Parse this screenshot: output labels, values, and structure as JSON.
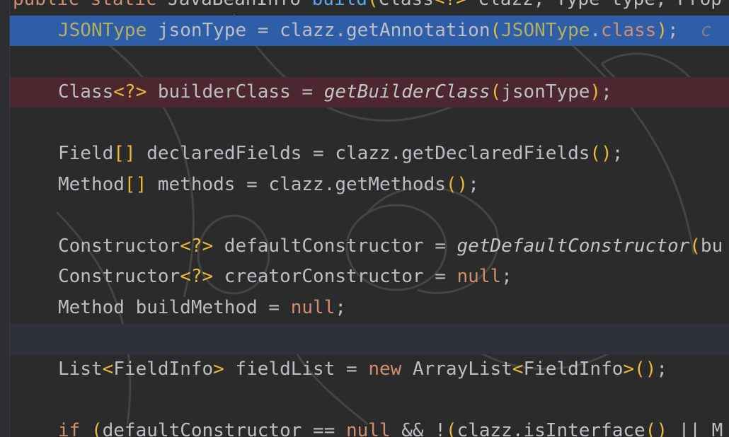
{
  "editor": {
    "lines": [
      {
        "kind": "plain",
        "tokens": [
          {
            "t": "kw",
            "v": "public "
          },
          {
            "t": "kw",
            "v": "static "
          },
          {
            "t": "ty",
            "v": "JavaBeanInfo "
          },
          {
            "t": "fn",
            "v": "build"
          },
          {
            "t": "br",
            "v": "("
          },
          {
            "t": "ty",
            "v": "Class"
          },
          {
            "t": "br",
            "v": "<?>"
          },
          {
            "t": "ty",
            "v": " clazz, Type type, Prop"
          }
        ]
      },
      {
        "kind": "selected",
        "tokens": [
          {
            "t": "an",
            "v": "JSONType"
          },
          {
            "t": "ty",
            "v": " jsonType = clazz.getAnnotation"
          },
          {
            "t": "br",
            "v": "("
          },
          {
            "t": "an",
            "v": "JSONType"
          },
          {
            "t": "ty",
            "v": "."
          },
          {
            "t": "kw",
            "v": "class"
          },
          {
            "t": "br",
            "v": ")"
          },
          {
            "t": "ty",
            "v": ";  "
          },
          {
            "t": "cmt",
            "v": "c"
          }
        ]
      },
      {
        "kind": "plain",
        "tokens": []
      },
      {
        "kind": "breakpoint",
        "tokens": [
          {
            "t": "ty",
            "v": "Class"
          },
          {
            "t": "br",
            "v": "<?>"
          },
          {
            "t": "ty",
            "v": " builderClass = "
          },
          {
            "t": "ital",
            "v": "getBuilderClass"
          },
          {
            "t": "br",
            "v": "("
          },
          {
            "t": "ty",
            "v": "jsonType"
          },
          {
            "t": "br",
            "v": ")"
          },
          {
            "t": "ty",
            "v": ";"
          }
        ]
      },
      {
        "kind": "plain",
        "tokens": []
      },
      {
        "kind": "plain",
        "tokens": [
          {
            "t": "ty",
            "v": "Field"
          },
          {
            "t": "br",
            "v": "[]"
          },
          {
            "t": "ty",
            "v": " declaredFields = clazz.getDeclaredFields"
          },
          {
            "t": "br",
            "v": "()"
          },
          {
            "t": "ty",
            "v": ";"
          }
        ]
      },
      {
        "kind": "plain",
        "tokens": [
          {
            "t": "ty",
            "v": "Method"
          },
          {
            "t": "br",
            "v": "[]"
          },
          {
            "t": "ty",
            "v": " methods = clazz.getMethods"
          },
          {
            "t": "br",
            "v": "()"
          },
          {
            "t": "ty",
            "v": ";"
          }
        ]
      },
      {
        "kind": "plain",
        "tokens": []
      },
      {
        "kind": "plain",
        "tokens": [
          {
            "t": "ty",
            "v": "Constructor"
          },
          {
            "t": "br",
            "v": "<?>"
          },
          {
            "t": "ty",
            "v": " defaultConstructor = "
          },
          {
            "t": "ital",
            "v": "getDefaultConstructor"
          },
          {
            "t": "br",
            "v": "("
          },
          {
            "t": "ty",
            "v": "bu"
          }
        ]
      },
      {
        "kind": "plain",
        "tokens": [
          {
            "t": "ty",
            "v": "Constructor"
          },
          {
            "t": "br",
            "v": "<?>"
          },
          {
            "t": "ty",
            "v": " creatorConstructor = "
          },
          {
            "t": "kw",
            "v": "null"
          },
          {
            "t": "ty",
            "v": ";"
          }
        ]
      },
      {
        "kind": "plain",
        "tokens": [
          {
            "t": "ty",
            "v": "Method buildMethod = "
          },
          {
            "t": "kw",
            "v": "null"
          },
          {
            "t": "ty",
            "v": ";"
          }
        ]
      },
      {
        "kind": "caret",
        "tokens": []
      },
      {
        "kind": "plain",
        "tokens": [
          {
            "t": "ty",
            "v": "List"
          },
          {
            "t": "br",
            "v": "<"
          },
          {
            "t": "ty",
            "v": "FieldInfo"
          },
          {
            "t": "br",
            "v": ">"
          },
          {
            "t": "ty",
            "v": " fieldList = "
          },
          {
            "t": "kw",
            "v": "new "
          },
          {
            "t": "ty",
            "v": "ArrayList"
          },
          {
            "t": "br",
            "v": "<"
          },
          {
            "t": "ty",
            "v": "FieldInfo"
          },
          {
            "t": "br",
            "v": ">()"
          },
          {
            "t": "ty",
            "v": ";"
          }
        ]
      },
      {
        "kind": "plain",
        "tokens": []
      },
      {
        "kind": "plain",
        "tokens": [
          {
            "t": "kw",
            "v": "if "
          },
          {
            "t": "br",
            "v": "("
          },
          {
            "t": "ty",
            "v": "defaultConstructor == "
          },
          {
            "t": "kw",
            "v": "null "
          },
          {
            "t": "ty",
            "v": "&& !"
          },
          {
            "t": "br",
            "v": "("
          },
          {
            "t": "ty",
            "v": "clazz.isInterface"
          },
          {
            "t": "br",
            "v": "()"
          },
          {
            "t": "ty",
            "v": " || M"
          }
        ]
      }
    ]
  },
  "colors": {
    "selection": "#2e5aa3",
    "breakpoint_line": "#4d2730",
    "caret_line": "#2e3138",
    "keyword": "#cf8e6d",
    "bracket": "#e8ba36",
    "default_text": "#bcbec4"
  }
}
